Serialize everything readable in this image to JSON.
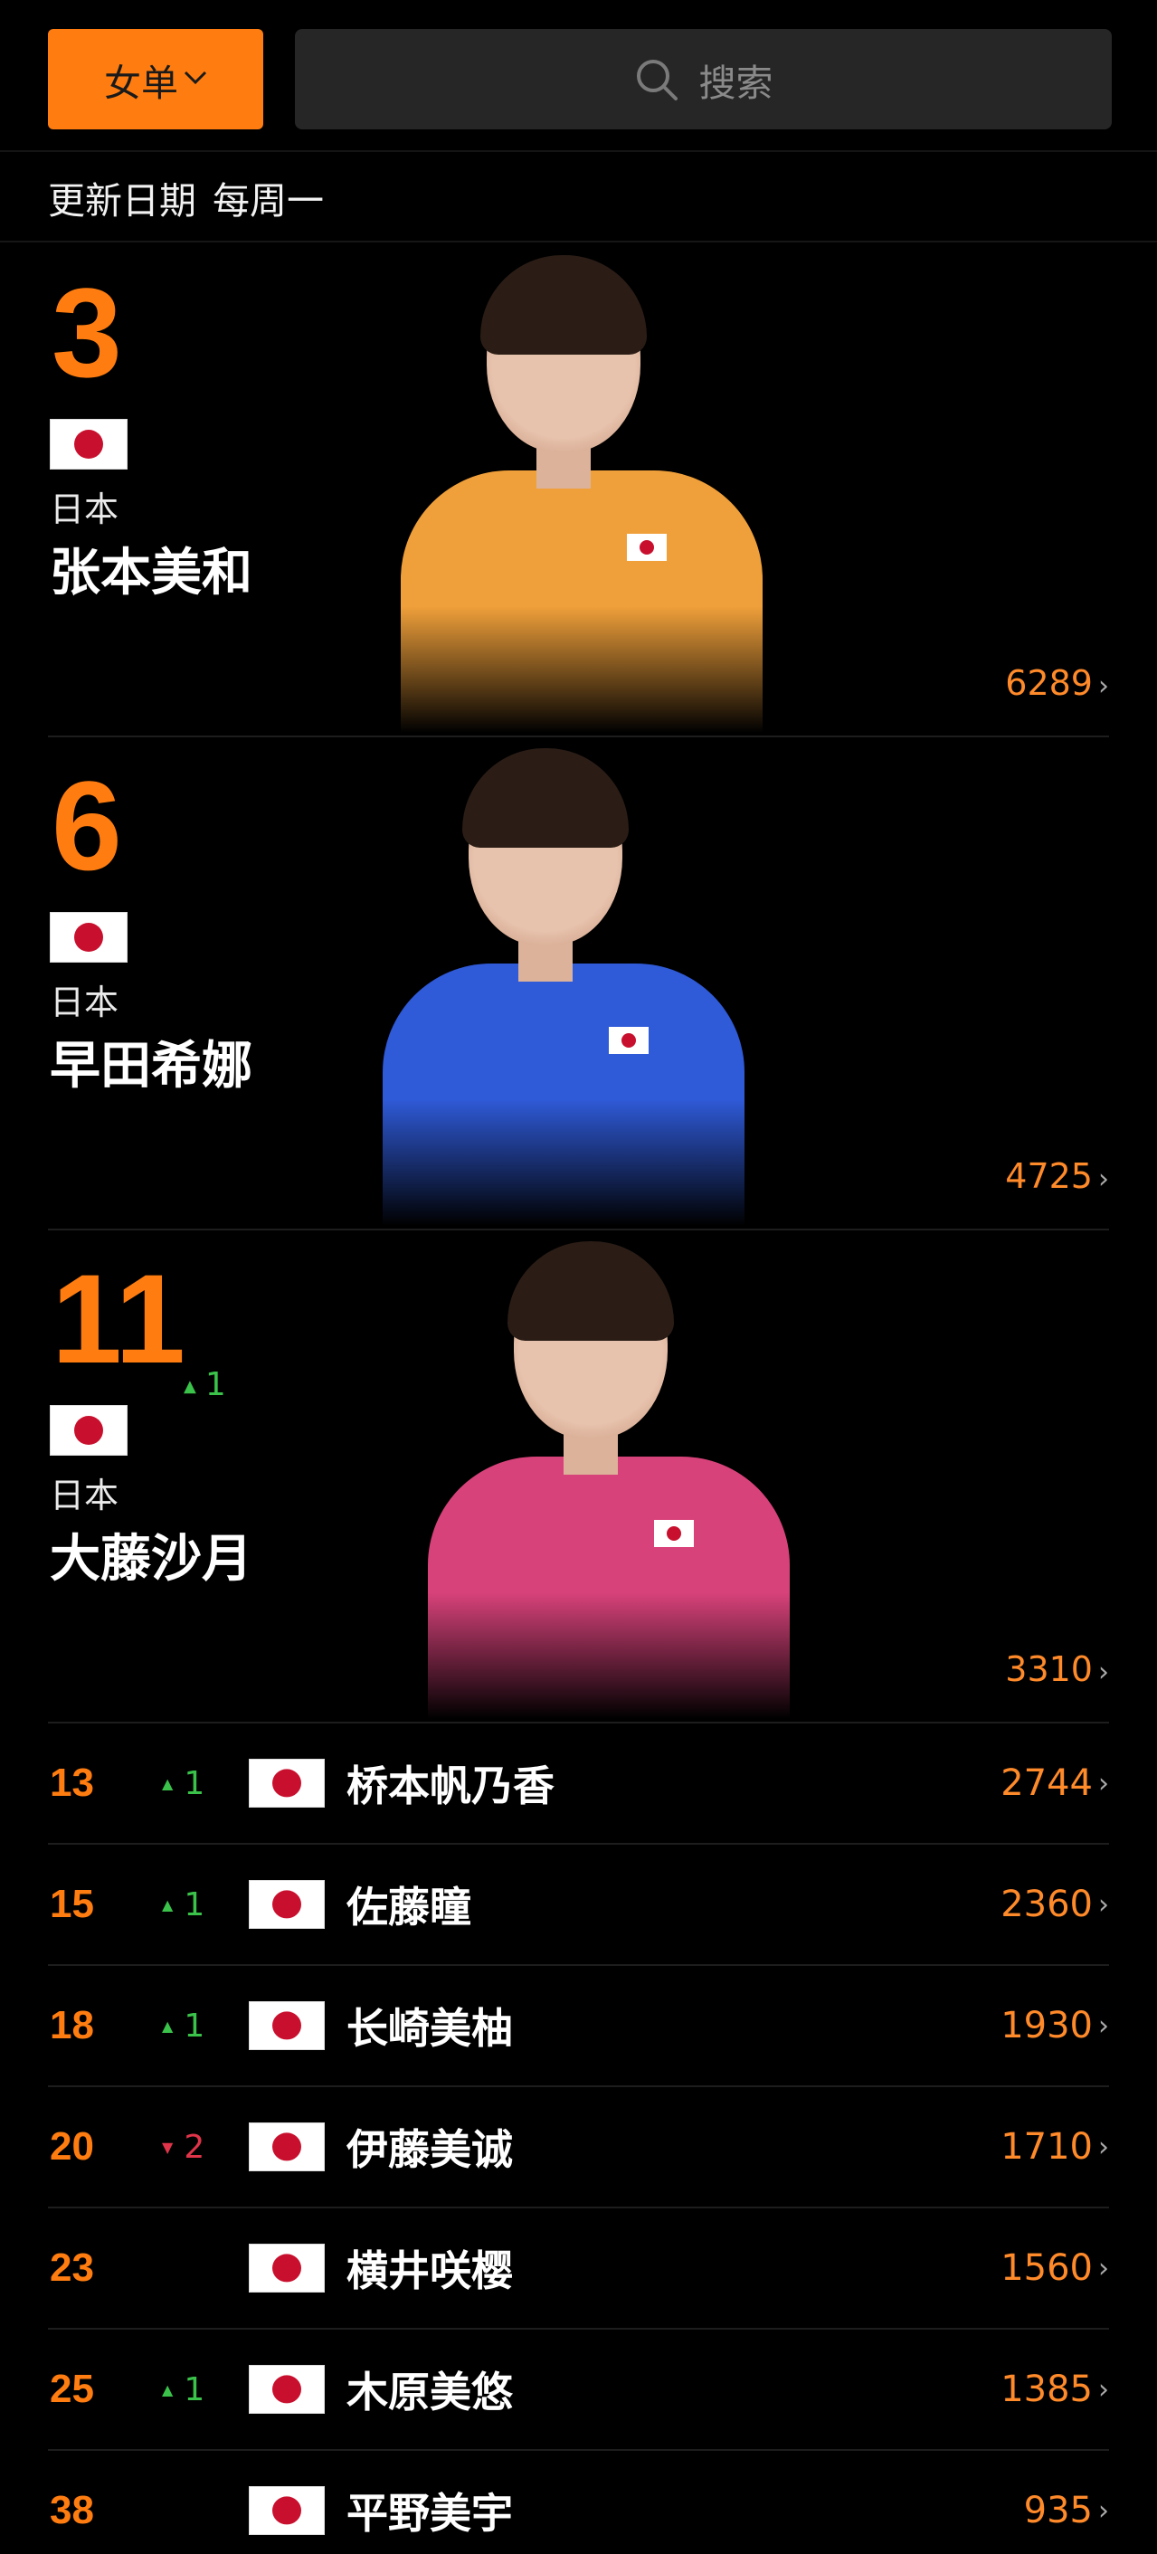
{
  "header": {
    "filter_label": "女单",
    "search_placeholder": "搜索"
  },
  "update": {
    "label": "更新日期",
    "value": "每周一"
  },
  "featured": [
    {
      "rank": "3",
      "change": "",
      "change_dir": "",
      "country": "日本",
      "name": "张本美和",
      "points": "6289",
      "jersey_color": "#f0a03a"
    },
    {
      "rank": "6",
      "change": "",
      "change_dir": "",
      "country": "日本",
      "name": "早田希娜",
      "points": "4725",
      "jersey_color": "#2f5ad8"
    },
    {
      "rank": "11",
      "change": "1",
      "change_dir": "up",
      "country": "日本",
      "name": "大藤沙月",
      "points": "3310",
      "jersey_color": "#d8427a"
    }
  ],
  "list": [
    {
      "rank": "13",
      "change": "1",
      "change_dir": "up",
      "name": "桥本帆乃香",
      "points": "2744"
    },
    {
      "rank": "15",
      "change": "1",
      "change_dir": "up",
      "name": "佐藤瞳",
      "points": "2360"
    },
    {
      "rank": "18",
      "change": "1",
      "change_dir": "up",
      "name": "长崎美柚",
      "points": "1930"
    },
    {
      "rank": "20",
      "change": "2",
      "change_dir": "down",
      "name": "伊藤美诚",
      "points": "1710"
    },
    {
      "rank": "23",
      "change": "",
      "change_dir": "",
      "name": "横井咲樱",
      "points": "1560"
    },
    {
      "rank": "25",
      "change": "1",
      "change_dir": "up",
      "name": "木原美悠",
      "points": "1385"
    },
    {
      "rank": "38",
      "change": "",
      "change_dir": "",
      "name": "平野美宇",
      "points": "935"
    }
  ],
  "icons": {
    "search": "search-icon",
    "chevron": "chevron-right-icon",
    "flag": "japan-flag-icon"
  },
  "colors": {
    "accent": "#ff7d10",
    "up": "#3ac24a",
    "down": "#e0344a"
  }
}
